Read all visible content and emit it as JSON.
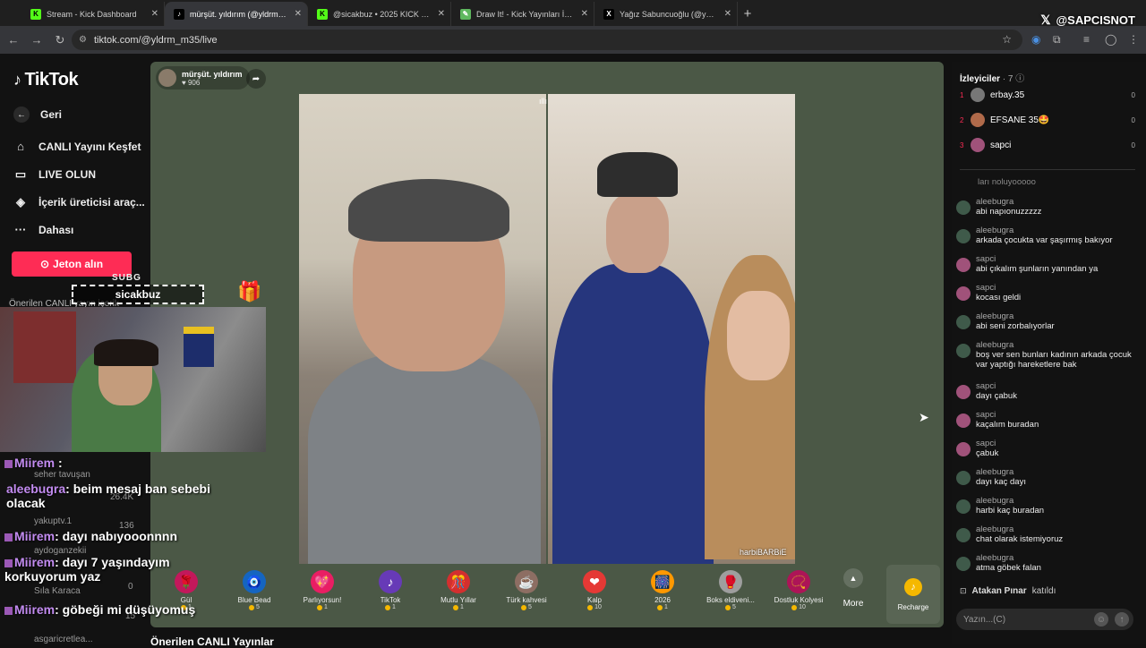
{
  "tabs": [
    {
      "label": "Stream - Kick Dashboard",
      "favicon": "K",
      "color": "#53fc18",
      "fg": "#000",
      "active": false
    },
    {
      "label": "mürşüt. yıldırım (@yldrm_m",
      "favicon": "♪",
      "color": "#000",
      "fg": "#fff",
      "active": true
    },
    {
      "label": "@sicakbuz • 2025 KICK WRAPP",
      "favicon": "K",
      "color": "#53fc18",
      "fg": "#000",
      "active": false
    },
    {
      "label": "Draw It! - Kick Yayınları İçin Çizi",
      "favicon": "✎",
      "color": "#5fb85f",
      "fg": "#fff",
      "active": false
    },
    {
      "label": "Yağız Sabuncuoğlu (@yagosab",
      "favicon": "X",
      "color": "#000",
      "fg": "#fff",
      "active": false
    }
  ],
  "url": "tiktok.com/@yldrm_m35/live",
  "watermark": "@SAPCISNOT",
  "sidebar": {
    "logo": "TikTok",
    "back": "Geri",
    "explore": "CANLI Yayını Keşfet",
    "go_live": "LIVE OLUN",
    "creator": "İçerik üreticisi araç...",
    "more": "Dahası",
    "jeton": "Jeton alın",
    "recommended": "Önerilen CANLI yayın içerik"
  },
  "host": {
    "name": "mürşüt. yıldırım",
    "likes": "906"
  },
  "video_caption": "harbiBARBiE",
  "gifts": [
    {
      "name": "Gül",
      "price": "1",
      "icon": "🌹",
      "color": "#c2185b"
    },
    {
      "name": "Blue Bead",
      "price": "5",
      "icon": "🧿",
      "color": "#1565c0"
    },
    {
      "name": "Parlıyorsun!",
      "price": "1",
      "icon": "💖",
      "color": "#e91e63"
    },
    {
      "name": "TikTok",
      "price": "1",
      "icon": "♪",
      "color": "#673ab7"
    },
    {
      "name": "Mutlu Yıllar",
      "price": "1",
      "icon": "🎊",
      "color": "#d32f2f"
    },
    {
      "name": "Türk kahvesi",
      "price": "5",
      "icon": "☕",
      "color": "#8d6e63"
    },
    {
      "name": "Kalp",
      "price": "10",
      "icon": "❤",
      "color": "#e53935"
    },
    {
      "name": "2026",
      "price": "1",
      "icon": "🎆",
      "color": "#ff9800"
    },
    {
      "name": "Boks eldiveni...",
      "price": "5",
      "icon": "🥊",
      "color": "#9e9e9e"
    },
    {
      "name": "Dostluk Kolyesi",
      "price": "10",
      "icon": "📿",
      "color": "#ad1457"
    }
  ],
  "more_label": "More",
  "recharge_label": "Recharge",
  "bottom_heading": "Önerilen CANLI Yayınlar",
  "stream": {
    "sub_tag": "SUBG",
    "channel": "sicakbuz"
  },
  "overlay": {
    "ghost": [
      "seher tavuşan",
      "26.4K",
      "yakuptv.1",
      "136",
      "aydoganzekii",
      "0",
      "Sıla Karaca",
      "15",
      "asgaricretlea..."
    ],
    "messages": [
      {
        "user": "Miirem",
        "text": " :"
      },
      {
        "user": "aleebugra",
        "text": ": beim mesaj ban sebebi olacak"
      },
      {
        "user": "Miirem",
        "text": ": dayı nabıyooonnnn"
      },
      {
        "user": "Miirem",
        "text": ": dayı 7 yaşındayım korkuyorum yaz"
      },
      {
        "user": "Miirem",
        "text": ": göbeği mi düşüyomuş"
      }
    ]
  },
  "viewers_panel": {
    "title": "İzleyiciler",
    "count": "7",
    "viewers": [
      {
        "rank": "1",
        "name": "erbay.35",
        "score": "0",
        "color": "#777"
      },
      {
        "rank": "2",
        "name": "EFSANE 35🤩",
        "score": "0",
        "color": "#b06a4a"
      },
      {
        "rank": "3",
        "name": "sapci",
        "score": "0",
        "color": "#a0527a"
      }
    ]
  },
  "chat": {
    "messages": [
      {
        "user": "",
        "msg": "ları noluyooooo",
        "color": "#333"
      },
      {
        "user": "aleebugra",
        "msg": "abi napıonuzzzzz",
        "color": "#3f5a4a"
      },
      {
        "user": "aleebugra",
        "msg": "arkada çocukta var şaşırmış bakıyor",
        "color": "#3f5a4a"
      },
      {
        "user": "sapci",
        "msg": "abi çıkalım şunların yanından ya",
        "color": "#a0527a"
      },
      {
        "user": "sapci",
        "msg": "kocası geldi",
        "color": "#a0527a"
      },
      {
        "user": "aleebugra",
        "msg": "abi seni zorbalıyorlar",
        "color": "#3f5a4a"
      },
      {
        "user": "aleebugra",
        "msg": "boş ver sen bunları kadının arkada çocuk var yaptığı hareketlere bak",
        "color": "#3f5a4a"
      },
      {
        "user": "sapci",
        "msg": "dayı çabuk",
        "color": "#a0527a"
      },
      {
        "user": "sapci",
        "msg": "kaçalım buradan",
        "color": "#a0527a"
      },
      {
        "user": "sapci",
        "msg": "çabuk",
        "color": "#a0527a"
      },
      {
        "user": "aleebugra",
        "msg": "dayı kaç dayı",
        "color": "#3f5a4a"
      },
      {
        "user": "aleebugra",
        "msg": "harbi kaç buradan",
        "color": "#3f5a4a"
      },
      {
        "user": "aleebugra",
        "msg": "chat olarak istemiyoruz",
        "color": "#3f5a4a"
      },
      {
        "user": "aleebugra",
        "msg": "atma göbek falan",
        "color": "#3f5a4a"
      }
    ],
    "join_user": "Atakan Pınar",
    "join_text": "katıldı",
    "input_placeholder": "Yazın...(C)"
  }
}
